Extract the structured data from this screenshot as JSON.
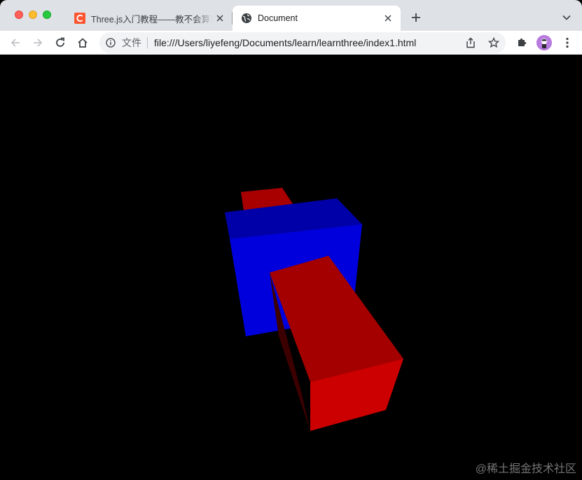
{
  "tabs": [
    {
      "title": "Three.js入门教程——教不会算我",
      "favicon": "csdn-c-icon",
      "active": false
    },
    {
      "title": "Document",
      "favicon": "globe-icon",
      "active": true
    }
  ],
  "omnibox": {
    "scheme_label": "文件",
    "url": "file:///Users/liyefeng/Documents/learn/learnthree/index1.html"
  },
  "watermark": "@稀土掘金技术社区",
  "colors": {
    "tabstrip_bg": "#dee1e6",
    "csdn_red": "#fc5531",
    "blue_box_front": "#0000dd",
    "blue_box_top": "#0000a8",
    "red_box_front": "#cc0000",
    "red_box_top": "#a60000",
    "red_box_side": "#4a0000",
    "viewport_bg": "#000000"
  }
}
